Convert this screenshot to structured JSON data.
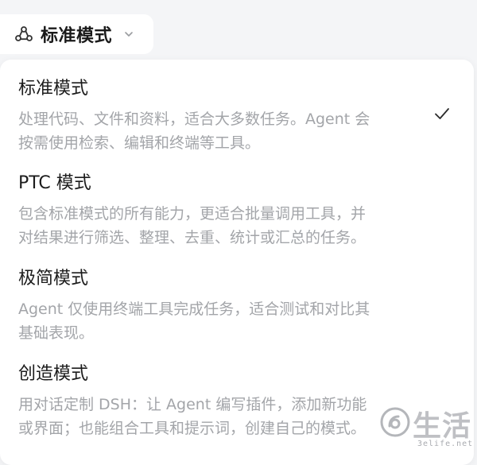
{
  "trigger": {
    "label": "标准模式",
    "icon": "agent-mode-icon",
    "chevron_icon": "chevron-down-icon"
  },
  "menu": {
    "items": [
      {
        "title": "标准模式",
        "desc_line1": "处理代码、文件和资料，适合大多数任务。Agent 会",
        "desc_line2": "按需使用检索、编辑和终端等工具。",
        "selected": true
      },
      {
        "title": "PTC 模式",
        "desc_line1": "包含标准模式的所有能力，更适合批量调用工具，并",
        "desc_line2": "对结果进行筛选、整理、去重、统计或汇总的任务。",
        "selected": false
      },
      {
        "title": "极简模式",
        "desc_line1": "Agent 仅使用终端工具完成任务，适合测试和对比其",
        "desc_line2": "基础表现。",
        "selected": false
      },
      {
        "title": "创造模式",
        "desc_line1": "用对话定制 DSH：让 Agent 编写插件，添加新功能",
        "desc_line2": "或界面；也能组合工具和提示词，创建自己的模式。",
        "selected": false
      }
    ],
    "check_icon": "checkmark-icon"
  },
  "watermark": {
    "text": "生活",
    "url": "3elife.net"
  },
  "colors": {
    "background": "#f4f5f7",
    "panel": "#ffffff",
    "title_text": "#1c1c1c",
    "desc_text": "#a3a5a9"
  }
}
